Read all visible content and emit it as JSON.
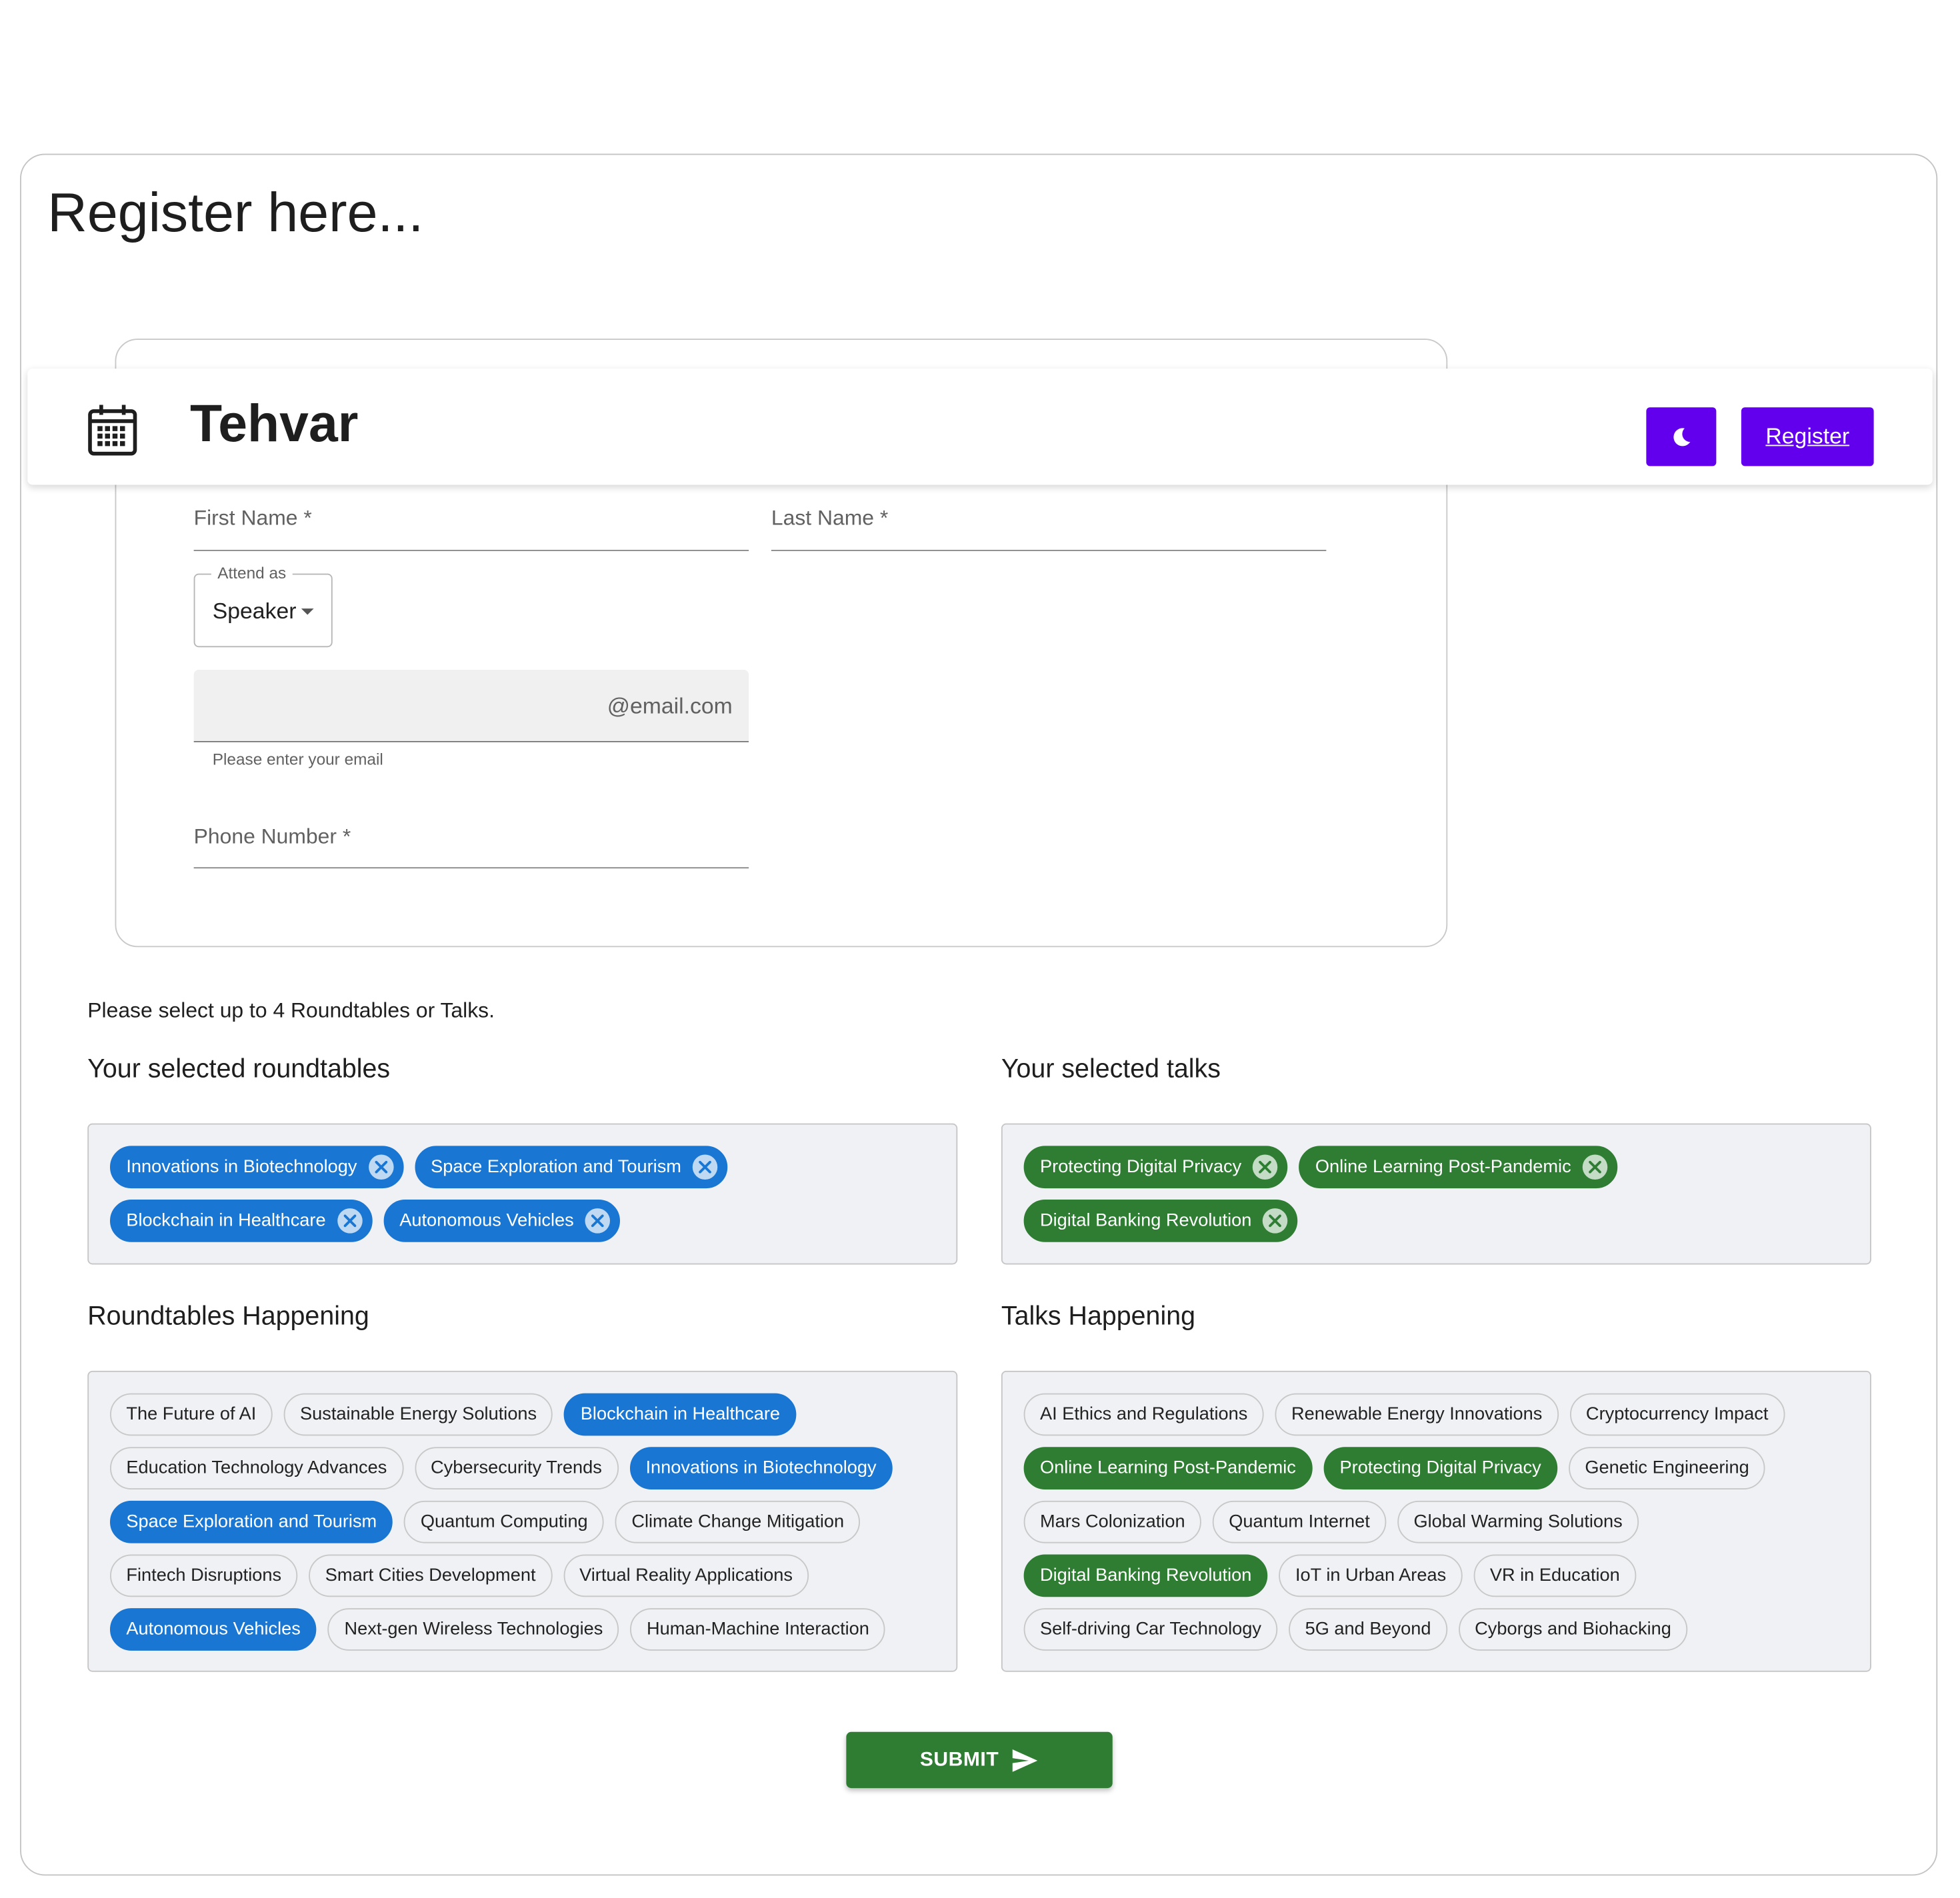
{
  "page": {
    "title": "Register here..."
  },
  "navbar": {
    "brand": "Tehvar",
    "register_label": "Register",
    "logo_icon": "calendar-icon",
    "theme_icon": "moon-icon",
    "accent": "#6200ee"
  },
  "form": {
    "first_name_label": "First Name *",
    "last_name_label": "Last Name *",
    "attend_as_label": "Attend as",
    "attend_as_value": "Speaker",
    "email_value": "",
    "email_suffix": "@email.com",
    "email_helper": "Please enter your email",
    "phone_label": "Phone Number *"
  },
  "instructions": "Please select up to 4 Roundtables or Talks.",
  "selected_roundtables": {
    "title": "Your selected roundtables",
    "chips": [
      "Innovations in Biotechnology",
      "Space Exploration and Tourism",
      "Blockchain in Healthcare",
      "Autonomous Vehicles"
    ]
  },
  "selected_talks": {
    "title": "Your selected talks",
    "chips": [
      "Protecting Digital Privacy",
      "Online Learning Post-Pandemic",
      "Digital Banking Revolution"
    ]
  },
  "roundtables": {
    "title": "Roundtables Happening",
    "chips": [
      {
        "label": "The Future of AI",
        "selected": false
      },
      {
        "label": "Sustainable Energy Solutions",
        "selected": false
      },
      {
        "label": "Blockchain in Healthcare",
        "selected": true
      },
      {
        "label": "Education Technology Advances",
        "selected": false
      },
      {
        "label": "Cybersecurity Trends",
        "selected": false
      },
      {
        "label": "Innovations in Biotechnology",
        "selected": true
      },
      {
        "label": "Space Exploration and Tourism",
        "selected": true
      },
      {
        "label": "Quantum Computing",
        "selected": false
      },
      {
        "label": "Climate Change Mitigation",
        "selected": false
      },
      {
        "label": "Fintech Disruptions",
        "selected": false
      },
      {
        "label": "Smart Cities Development",
        "selected": false
      },
      {
        "label": "Virtual Reality Applications",
        "selected": false
      },
      {
        "label": "Autonomous Vehicles",
        "selected": true
      },
      {
        "label": "Next-gen Wireless Technologies",
        "selected": false
      },
      {
        "label": "Human-Machine Interaction",
        "selected": false
      }
    ]
  },
  "talks": {
    "title": "Talks Happening",
    "chips": [
      {
        "label": "AI Ethics and Regulations",
        "selected": false
      },
      {
        "label": "Renewable Energy Innovations",
        "selected": false
      },
      {
        "label": "Cryptocurrency Impact",
        "selected": false
      },
      {
        "label": "Online Learning Post-Pandemic",
        "selected": true
      },
      {
        "label": "Protecting Digital Privacy",
        "selected": true
      },
      {
        "label": "Genetic Engineering",
        "selected": false
      },
      {
        "label": "Mars Colonization",
        "selected": false
      },
      {
        "label": "Quantum Internet",
        "selected": false
      },
      {
        "label": "Global Warming Solutions",
        "selected": false
      },
      {
        "label": "Digital Banking Revolution",
        "selected": true
      },
      {
        "label": "IoT in Urban Areas",
        "selected": false
      },
      {
        "label": "VR in Education",
        "selected": false
      },
      {
        "label": "Self-driving Car Technology",
        "selected": false
      },
      {
        "label": "5G and Beyond",
        "selected": false
      },
      {
        "label": "Cyborgs and Biohacking",
        "selected": false
      }
    ]
  },
  "submit": {
    "label": "SUBMIT",
    "icon": "send-icon"
  },
  "colors": {
    "roundtable_selected": "#1976d2",
    "talk_selected": "#2e7d32",
    "submit": "#2e7d32"
  }
}
